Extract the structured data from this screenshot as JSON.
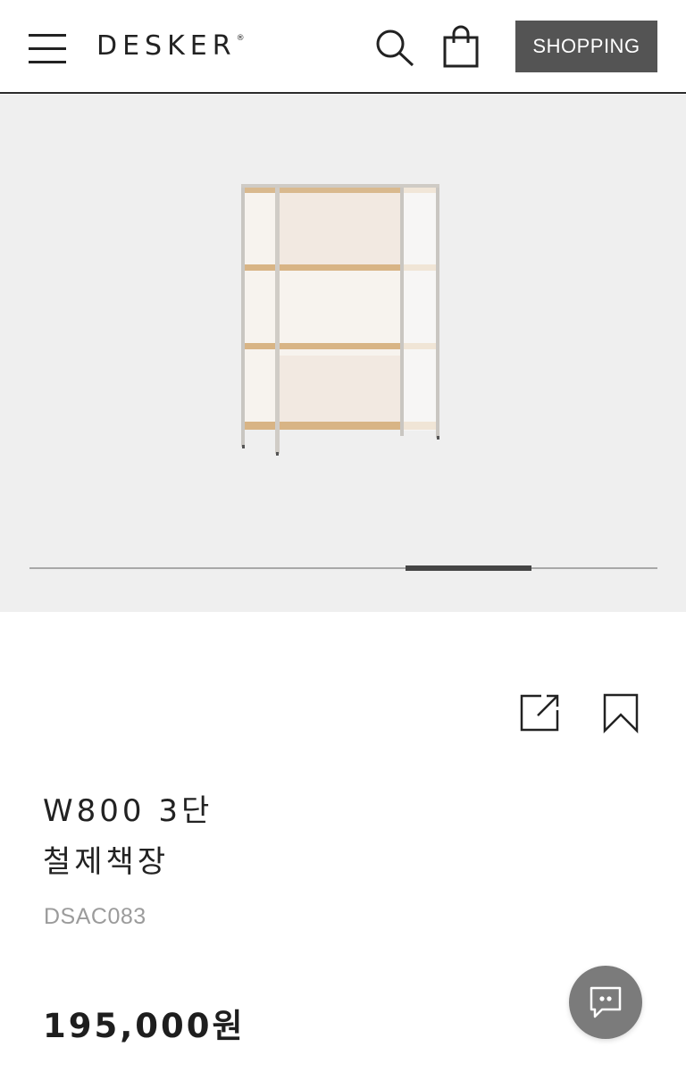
{
  "header": {
    "logo": "DESKER",
    "logo_mark": "®",
    "menu_icon": "hamburger-menu-icon",
    "search_icon": "search-icon",
    "cart_icon": "shopping-bag-icon",
    "shopping_label": "SHOPPING"
  },
  "gallery": {
    "image": "steel-bookshelf-3-tier",
    "progress": 0.2
  },
  "actions": {
    "share_icon": "share-icon",
    "bookmark_icon": "bookmark-icon"
  },
  "product": {
    "title_line1": "W800 3단",
    "title_line2": "철제책장",
    "code": "DSAC083",
    "price": "195,000원"
  },
  "chat": {
    "icon": "chat-bubble-icon"
  },
  "colors": {
    "accent": "#545454",
    "hero_bg": "#efefef",
    "chat_bg": "#7b7b7b"
  }
}
